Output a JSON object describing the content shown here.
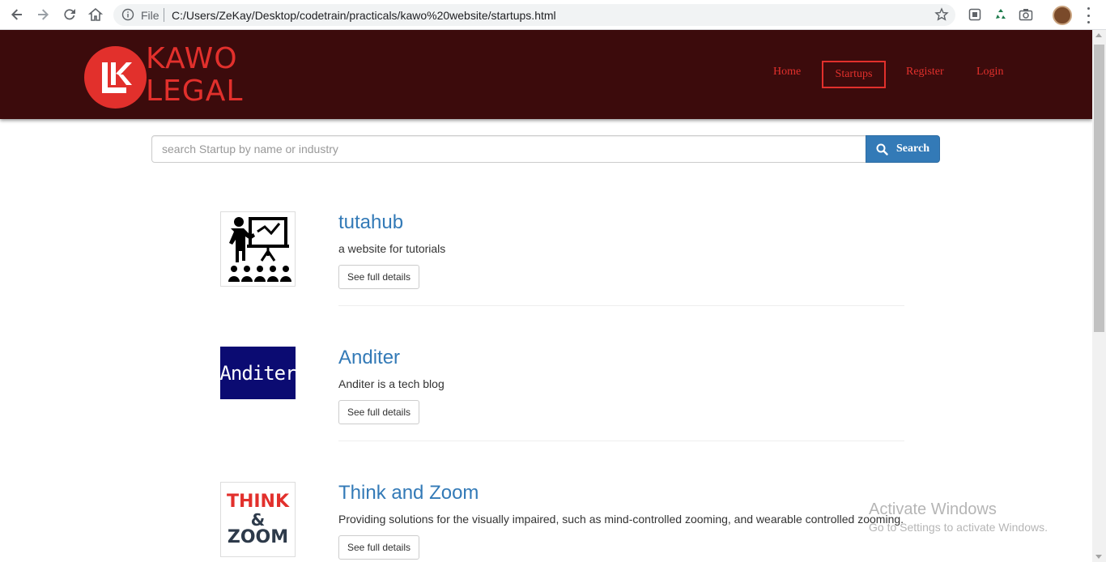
{
  "browser": {
    "url_scheme_label": "File",
    "url": "C:/Users/ZeKay/Desktop/codetrain/practicals/kawo%20website/startups.html"
  },
  "site": {
    "logo_line1": "KAWO",
    "logo_line2": "LEGAL",
    "brand_color": "#e2302c",
    "header_bg": "#3c0b0c"
  },
  "nav": {
    "home": "Home",
    "startups": "Startups",
    "register": "Register",
    "login": "Login",
    "active": "Startups"
  },
  "search": {
    "placeholder": "search Startup by name or industry",
    "button_label": "Search"
  },
  "startups": [
    {
      "name": "tutahub",
      "description": "a website for tutorials",
      "button": "See full details",
      "icon": "teacher-presentation-icon"
    },
    {
      "name": "Anditer",
      "description": "Anditer is a tech blog",
      "button": "See full details",
      "logo_text": "Anditer"
    },
    {
      "name": "Think and Zoom",
      "description": "Providing solutions for the visually impaired, such as mind-controlled zooming, and wearable controlled zooming.",
      "button": "See full details",
      "logo_line1": "THINK",
      "logo_line2": "&",
      "logo_line3": "ZOOM"
    }
  ],
  "watermark": {
    "title": "Activate Windows",
    "subtitle": "Go to Settings to activate Windows."
  }
}
